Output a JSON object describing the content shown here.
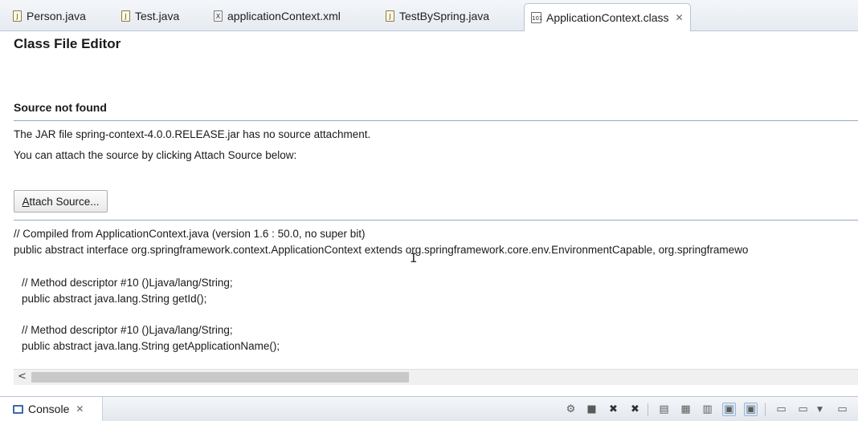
{
  "tabs": [
    {
      "label": "Person.java",
      "icon": "java-file-icon"
    },
    {
      "label": "Test.java",
      "icon": "java-file-icon"
    },
    {
      "label": "applicationContext.xml",
      "icon": "xml-file-icon"
    },
    {
      "label": "TestBySpring.java",
      "icon": "java-file-icon"
    },
    {
      "label": "ApplicationContext.class",
      "icon": "class-file-icon",
      "active": true
    }
  ],
  "editor": {
    "title": "Class File Editor",
    "source_heading": "Source not found",
    "message_1": "The JAR file spring-context-4.0.0.RELEASE.jar has no source attachment.",
    "message_2": "You can attach the source by clicking Attach Source below:",
    "attach_button": {
      "mnemonic": "A",
      "rest": "ttach Source..."
    }
  },
  "code_lines": [
    "// Compiled from ApplicationContext.java (version 1.6 : 50.0, no super bit)",
    "public abstract interface org.springframework.context.ApplicationContext extends org.springframework.core.env.EnvironmentCapable, org.springframewo",
    "// Method descriptor #10 ()Ljava/lang/String;",
    "public abstract java.lang.String getId();",
    "// Method descriptor #10 ()Ljava/lang/String;",
    "public abstract java.lang.String getApplicationName();"
  ],
  "console": {
    "label": "Console"
  },
  "colors": {
    "tab_strip": "#e6ebf1",
    "separator": "#97a9bf",
    "accent": "#3d6aa8"
  }
}
